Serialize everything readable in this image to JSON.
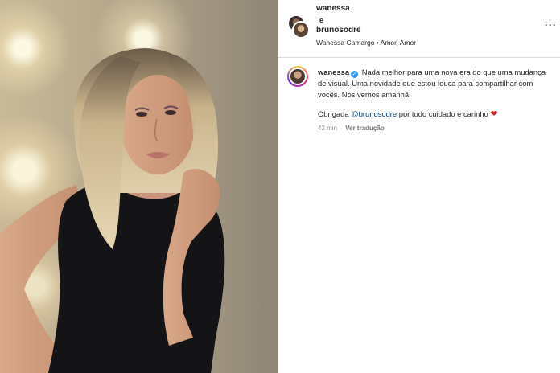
{
  "header": {
    "user_1": "wanessa",
    "conjunction": "e",
    "user_2": "brunosodre",
    "subtitle": "Wanessa Camargo • Amor, Amor",
    "more_icon": "more-dots-icon"
  },
  "caption": {
    "username": "wanessa",
    "verified_icon": "verified-badge-icon",
    "text": "Nada melhor para uma nova era do que uma mudança de visual. Uma novidade que estou louca para compartilhar com vocês. Nos vemos amanhã!",
    "thanks_prefix": "Obrigada ",
    "mention": "@brunosodre",
    "thanks_suffix": " por todo cuidado e carinho ",
    "heart_icon": "red-heart-icon",
    "time": "42 min",
    "translate_label": "Ver tradução"
  },
  "colors": {
    "verified": "#3897f0",
    "mention": "#00376b",
    "heart": "#d0242c"
  }
}
